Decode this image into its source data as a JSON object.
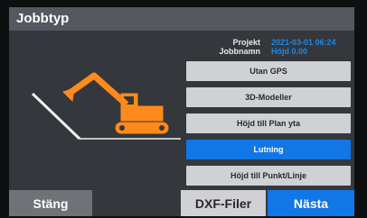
{
  "title": "Jobbtyp",
  "info": {
    "project_label": "Projekt",
    "project_value": "2021-03-01 06:24",
    "jobname_label": "Jobbnamn",
    "jobname_value": "Höjd 0.00"
  },
  "menu": [
    {
      "label": "Utan GPS",
      "active": false
    },
    {
      "label": "3D-Modeller",
      "active": false
    },
    {
      "label": "Höjd till Plan yta",
      "active": false
    },
    {
      "label": "Lutning",
      "active": true
    },
    {
      "label": "Höjd till Punkt/Linje",
      "active": false
    }
  ],
  "buttons": {
    "close": "Stäng",
    "dxf": "DXF-Filer",
    "next": "Nästa"
  },
  "colors": {
    "accent": "#1176e6",
    "excavator": "#ff8a1c",
    "panel": "#34373c",
    "titlebar": "#55595f"
  }
}
